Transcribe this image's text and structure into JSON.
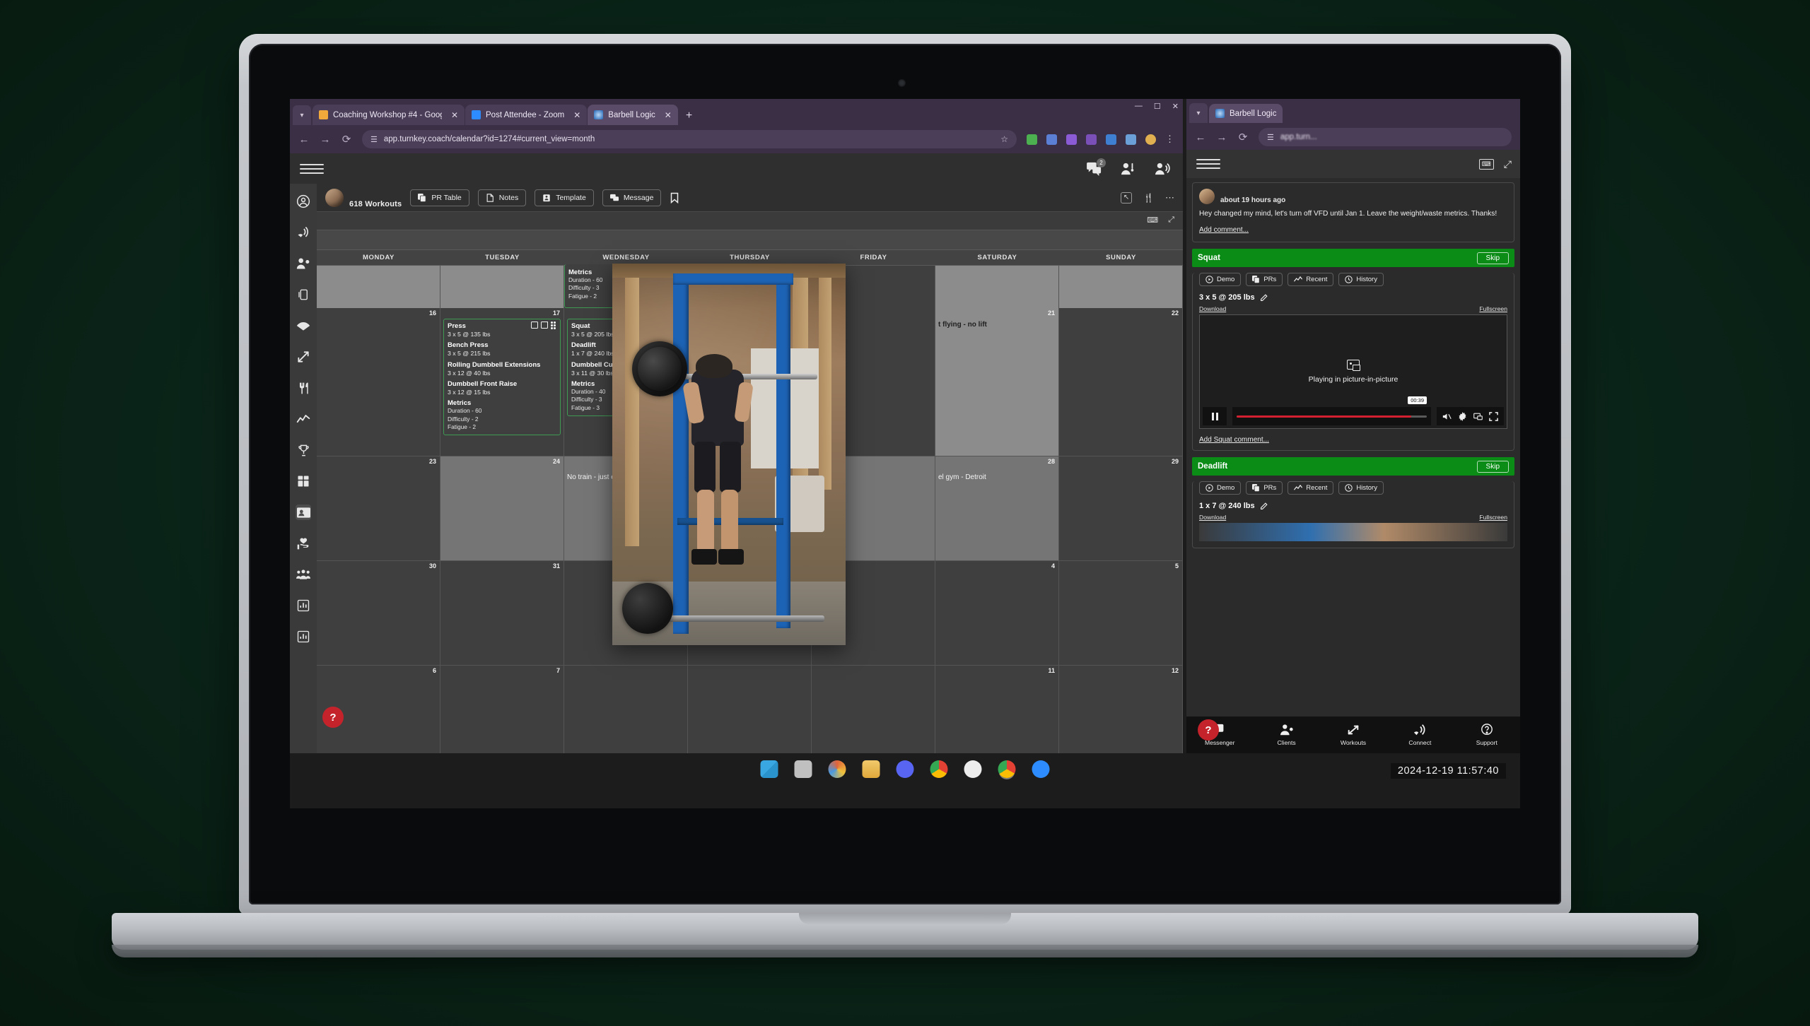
{
  "browser_main": {
    "tabs": [
      {
        "title": "Coaching Workshop #4 - Goog",
        "favicon": "#f2a93b",
        "active": false
      },
      {
        "title": "Post Attendee - Zoom",
        "favicon": "#2d8cff",
        "active": false
      },
      {
        "title": "Barbell Logic",
        "favicon": "#1d63b5",
        "active": true
      }
    ],
    "newtab_label": "+",
    "window_controls": {
      "minimize": "—",
      "maximize": "☐",
      "close": "✕"
    },
    "url": "app.turnkey.coach/calendar?id=1274#current_view=month"
  },
  "browser_right": {
    "tabs": [
      {
        "title": "Barbell Logic",
        "favicon": "#1d63b5",
        "active": true
      }
    ],
    "url": "app.turn..."
  },
  "app": {
    "header": {
      "workouts_count": "618 Workouts",
      "toolbar": [
        {
          "label": "PR Table",
          "icon": "copy-icon"
        },
        {
          "label": "Notes",
          "icon": "document-icon"
        },
        {
          "label": "Template",
          "icon": "clipboard-icon"
        },
        {
          "label": "Message",
          "icon": "chat-icon"
        }
      ],
      "bookmark_icon": "bookmark-icon",
      "right_icons": [
        "expand-icon",
        "filter-icon",
        "more-icon"
      ]
    },
    "topbar_icons": [
      {
        "name": "messages-icon",
        "badge": "2"
      },
      {
        "name": "add-client-icon",
        "badge": ""
      },
      {
        "name": "broadcast-icon",
        "badge": ""
      }
    ],
    "sidebar": [
      "profile-icon",
      "broadcast-icon",
      "clients-icon",
      "device-icon",
      "wifi-icon",
      "workouts-icon",
      "nutrition-icon",
      "trend-icon",
      "trophy-icon",
      "dashboard-icon",
      "contact-card-icon",
      "heart-hand-icon",
      "community-icon",
      "reports-icon",
      "stats-icon"
    ],
    "help_label": "?"
  },
  "calendar": {
    "day_names": [
      "MONDAY",
      "TUESDAY",
      "WEDNESDAY",
      "THURSDAY",
      "FRIDAY",
      "SATURDAY",
      "SUNDAY"
    ],
    "weeks": [
      {
        "days": [
          {
            "num": "",
            "shade": true
          },
          {
            "num": "",
            "shade": true
          },
          {
            "num": "",
            "card": {
              "metrics_only": true,
              "metrics_title": "Metrics",
              "metrics": [
                "Duration - 60",
                "Difficulty - 3",
                "Fatigue - 2"
              ]
            }
          },
          {
            "num": "",
            "hidden_by_pip": true
          },
          {
            "num": "",
            "hidden_by_pip": true
          },
          {
            "num": "",
            "shade": true
          },
          {
            "num": "",
            "shade": true
          }
        ]
      },
      {
        "days": [
          {
            "num": "16"
          },
          {
            "num": "17",
            "card": {
              "exercises": [
                {
                  "name": "Press",
                  "sets": "3 x 5 @ 135 lbs"
                },
                {
                  "name": "Bench Press",
                  "sets": "3 x 5 @ 215 lbs"
                },
                {
                  "name": "Rolling Dumbbell Extensions",
                  "sets": "3 x 12 @ 40 lbs"
                },
                {
                  "name": "Dumbbell Front Raise",
                  "sets": "3 x 12 @ 15 lbs"
                }
              ],
              "metrics_title": "Metrics",
              "metrics": [
                "Duration - 60",
                "Difficulty - 2",
                "Fatigue - 2"
              ],
              "tools": [
                "checkbox-icon",
                "open-external-icon",
                "drag-handle-icon"
              ]
            }
          },
          {
            "num": "",
            "card": {
              "exercises": [
                {
                  "name": "Squat",
                  "sets": "3 x 5 @ 205 lbs"
                },
                {
                  "name": "Deadlift",
                  "sets": "1 x 7 @ 240 lbs"
                },
                {
                  "name": "Dumbbell Curl",
                  "sets": "3 x 11 @ 30 lbs"
                }
              ],
              "metrics_title": "Metrics",
              "metrics": [
                "Duration - 40",
                "Difficulty - 3",
                "Fatigue - 3"
              ],
              "tools": [
                "checkbox-icon",
                "open-external-icon"
              ]
            }
          },
          {
            "num": "",
            "hidden_by_pip": true
          },
          {
            "num": "",
            "hidden_by_pip": true
          },
          {
            "num": "21",
            "shade": true,
            "text": "t flying - no lift"
          },
          {
            "num": "22"
          }
        ]
      },
      {
        "days": [
          {
            "num": "23"
          },
          {
            "num": "24",
            "shade2": true
          },
          {
            "num": "",
            "shade2": true,
            "text": "No train - just ea"
          },
          {
            "num": "",
            "hidden_by_pip": true
          },
          {
            "num": "",
            "hidden_by_pip": true
          },
          {
            "num": "28",
            "shade2": true,
            "text": "el gym - Detroit"
          },
          {
            "num": "29"
          }
        ]
      },
      {
        "days": [
          {
            "num": "30"
          },
          {
            "num": "31"
          },
          {
            "num": ""
          },
          {
            "num": ""
          },
          {
            "num": ""
          },
          {
            "num": "4"
          },
          {
            "num": "5"
          }
        ]
      },
      {
        "days": [
          {
            "num": "6"
          },
          {
            "num": "7"
          },
          {
            "num": ""
          },
          {
            "num": ""
          },
          {
            "num": ""
          },
          {
            "num": "11"
          },
          {
            "num": "12"
          }
        ]
      }
    ]
  },
  "pip_video": {
    "caption": "squat-video-picture-in-picture"
  },
  "right_panel": {
    "comment": {
      "time": "about 19 hours ago",
      "text": "Hey changed my mind, let's turn off VFD until Jan 1. Leave the weight/waste metrics. Thanks!",
      "add_comment": "Add comment..."
    },
    "exercises": [
      {
        "name": "Squat",
        "skip": "Skip",
        "buttons": [
          {
            "label": "Demo",
            "icon": "play-circle-icon"
          },
          {
            "label": "PRs",
            "icon": "copy-icon"
          },
          {
            "label": "Recent",
            "icon": "trend-icon"
          },
          {
            "label": "History",
            "icon": "history-icon"
          }
        ],
        "sets": "3 x 5 @ 205 lbs",
        "edit_icon": "pencil-icon",
        "download": "Download",
        "fullscreen": "Fullscreen",
        "video_message": "Playing in picture-in-picture",
        "video_time": "00:39",
        "add_comment": "Add Squat comment..."
      },
      {
        "name": "Deadlift",
        "skip": "Skip",
        "buttons": [
          {
            "label": "Demo",
            "icon": "play-circle-icon"
          },
          {
            "label": "PRs",
            "icon": "copy-icon"
          },
          {
            "label": "Recent",
            "icon": "trend-icon"
          },
          {
            "label": "History",
            "icon": "history-icon"
          }
        ],
        "sets": "1 x 7 @ 240 lbs",
        "edit_icon": "pencil-icon",
        "download": "Download",
        "fullscreen": "Fullscreen"
      }
    ],
    "bottom_nav": [
      {
        "label": "Messenger",
        "icon": "messenger-icon"
      },
      {
        "label": "Clients",
        "icon": "clients-icon"
      },
      {
        "label": "Workouts",
        "icon": "workouts-icon"
      },
      {
        "label": "Connect",
        "icon": "broadcast-icon"
      },
      {
        "label": "Support",
        "icon": "support-icon"
      }
    ],
    "help_label": "?"
  },
  "taskbar": {
    "clock": "2024-12-19 11:57:40",
    "items": [
      {
        "name": "start-icon",
        "color": "#3ba7e0"
      },
      {
        "name": "task-view-icon",
        "color": "#c8c8c8"
      },
      {
        "name": "photos-icon",
        "color": "#e0643b"
      },
      {
        "name": "file-explorer-icon",
        "color": "#e8b84b"
      },
      {
        "name": "discord-icon",
        "color": "#5865f2"
      },
      {
        "name": "chrome-icon",
        "color": "#e34133"
      },
      {
        "name": "app-icon",
        "color": "#ededed"
      },
      {
        "name": "chrome-profile-icon",
        "color": "#4285f4"
      },
      {
        "name": "zoom-icon",
        "color": "#2d8cff"
      }
    ]
  },
  "colors": {
    "accent_green": "#0a8c16",
    "card_border_green": "#3f9a54",
    "red": "#c4232b",
    "browser_chrome": "#3a2f45"
  }
}
